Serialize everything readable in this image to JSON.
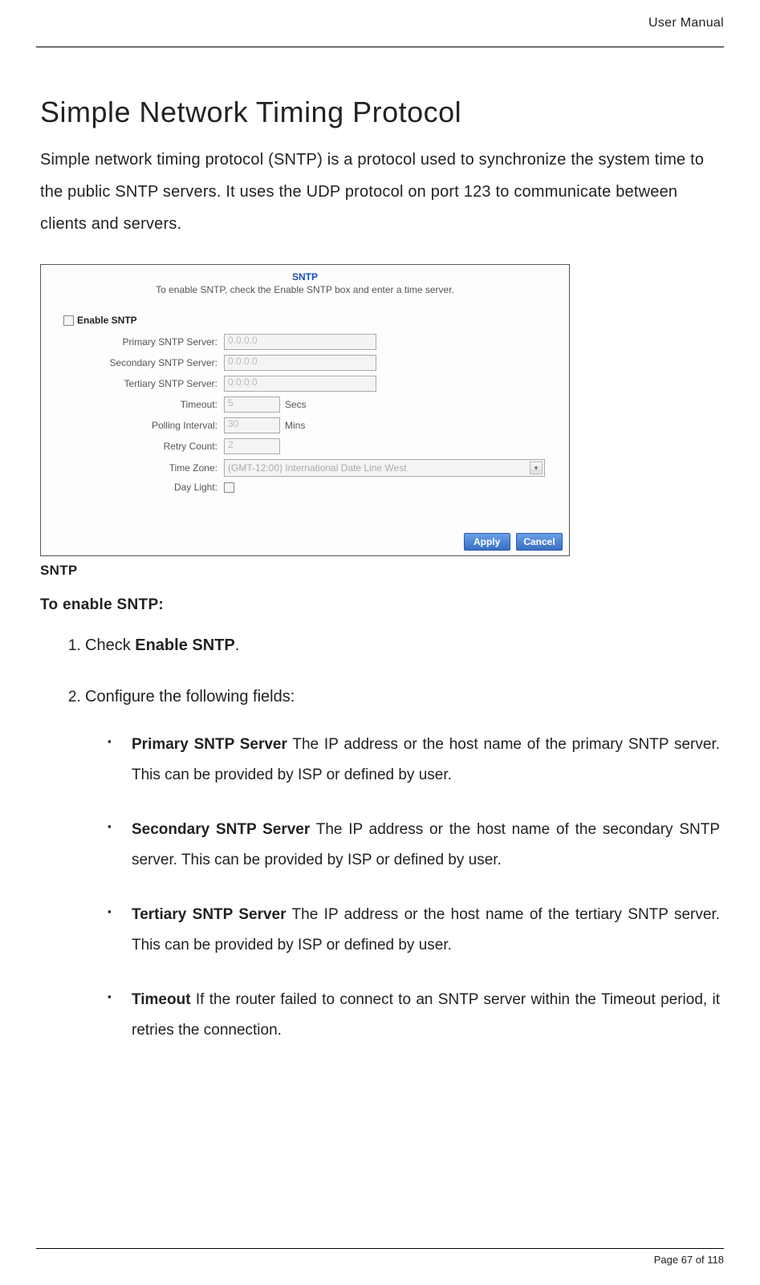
{
  "header": {
    "label": "User Manual"
  },
  "title": "Simple Network Timing Protocol",
  "intro": "Simple network timing protocol (SNTP) is a protocol used to synchronize the system time to the public SNTP servers. It uses the UDP protocol on port 123 to communicate between clients and servers.",
  "screenshot": {
    "title": "SNTP",
    "subtitle": "To enable SNTP, check the Enable SNTP box and enter a time server.",
    "enable_label": "Enable SNTP",
    "rows": {
      "primary": {
        "label": "Primary SNTP Server:",
        "value": "0.0.0.0"
      },
      "secondary": {
        "label": "Secondary SNTP Server:",
        "value": "0.0.0.0"
      },
      "tertiary": {
        "label": "Tertiary SNTP Server:",
        "value": "0.0.0.0"
      },
      "timeout": {
        "label": "Timeout:",
        "value": "5",
        "unit": "Secs"
      },
      "polling": {
        "label": "Polling Interval:",
        "value": "30",
        "unit": "Mins"
      },
      "retry": {
        "label": "Retry Count:",
        "value": "2"
      },
      "tz": {
        "label": "Time Zone:",
        "value": "(GMT-12:00) International Date Line West"
      },
      "daylight": {
        "label": "Day Light:"
      }
    },
    "buttons": {
      "apply": "Apply",
      "cancel": "Cancel"
    }
  },
  "caption": "SNTP",
  "section_heading": "To enable SNTP:",
  "steps": {
    "s1_pre": "Check ",
    "s1_bold": "Enable SNTP",
    "s1_post": ".",
    "s2": "Configure the following fields:"
  },
  "bullets": {
    "b1_bold": "Primary SNTP Server",
    "b1_text": " The IP address or the host name of the primary SNTP server. This can be provided by ISP or defined by user.",
    "b2_bold": "Secondary SNTP Server",
    "b2_text": " The IP address or the host name of the secondary SNTP server. This can be provided by ISP or defined by user.",
    "b3_bold": "Tertiary SNTP Server",
    "b3_text": " The IP address or the host name of the tertiary SNTP server. This can be provided by ISP or defined by user.",
    "b4_bold": "Timeout",
    "b4_text": " If the router failed to connect to an SNTP server within the Timeout period, it retries the connection."
  },
  "footer": {
    "text": "Page 67 of 118"
  }
}
